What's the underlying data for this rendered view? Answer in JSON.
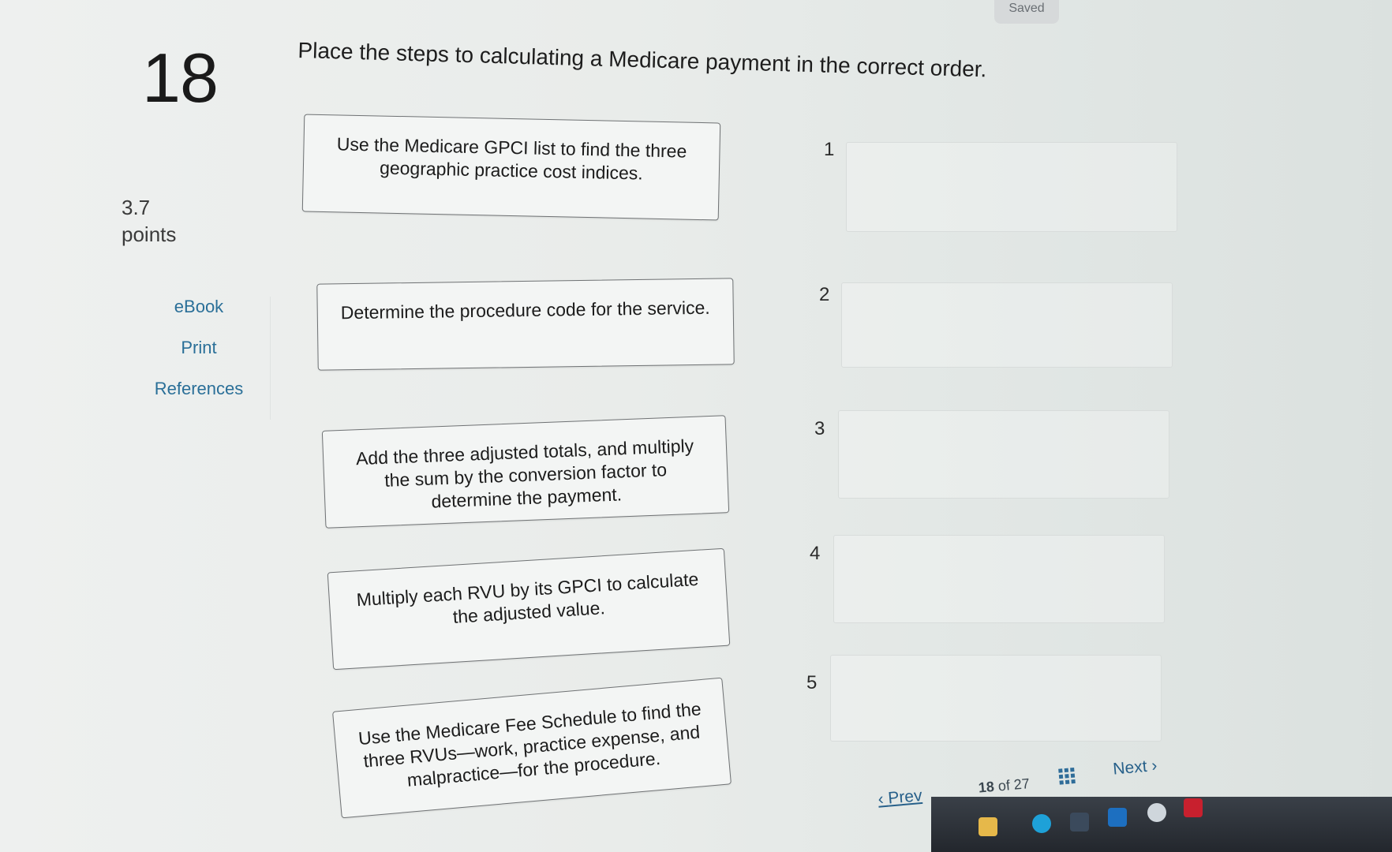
{
  "status": {
    "saved_label": "Saved"
  },
  "question": {
    "number": "18",
    "instruction": "Place the steps to calculating a Medicare payment in the correct order.",
    "points_value": "3.7",
    "points_label": "points"
  },
  "tools": {
    "ebook": "eBook",
    "print": "Print",
    "references": "References"
  },
  "cards": [
    {
      "text": "Use the Medicare GPCI list to find the three geographic practice cost indices."
    },
    {
      "text": "Determine the procedure code for the service."
    },
    {
      "text": "Add the three adjusted totals, and multiply the sum by the conversion factor to determine the payment."
    },
    {
      "text": "Multiply each RVU by its GPCI to calculate the adjusted value."
    },
    {
      "text": "Use the Medicare Fee Schedule to find the three RVUs—work, practice expense, and malpractice—for the procedure."
    }
  ],
  "slots": [
    "1",
    "2",
    "3",
    "4",
    "5"
  ],
  "nav": {
    "prev": "Prev",
    "current": "18",
    "of": "of",
    "total": "27",
    "next": "Next"
  }
}
